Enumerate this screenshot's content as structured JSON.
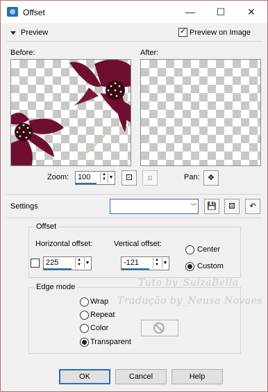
{
  "window": {
    "title": "Offset"
  },
  "controls": {
    "minimize": "—",
    "maximize": "☐",
    "close": "✕"
  },
  "preview": {
    "label": "Preview",
    "preview_on_image_label": "Preview on Image",
    "preview_on_image_checked": true
  },
  "panes": {
    "before_label": "Before:",
    "after_label": "After:"
  },
  "zoom": {
    "label": "Zoom:",
    "value": "100"
  },
  "pan": {
    "label": "Pan:"
  },
  "settings": {
    "label": "Settings",
    "preset_value": ""
  },
  "offset": {
    "group_label": "Offset",
    "horizontal_label": "Horizontal offset:",
    "horizontal_value": "225",
    "vertical_label": "Vertical offset:",
    "vertical_value": "-121",
    "center_label": "Center",
    "custom_label": "Custom",
    "selected": "Custom"
  },
  "edge_mode": {
    "group_label": "Edge mode",
    "options": [
      "Wrap",
      "Repeat",
      "Color",
      "Transparent"
    ],
    "selected": "Transparent"
  },
  "buttons": {
    "ok": "OK",
    "cancel": "Cancel",
    "help": "Help"
  },
  "watermark": {
    "line1": "Tuto by_SuizaBella",
    "line2": "Tradução by_Neusa Novaes"
  },
  "colors": {
    "accent": "#2a6db5",
    "flower": "#6e0f32",
    "checker": "#c8c8c8"
  }
}
